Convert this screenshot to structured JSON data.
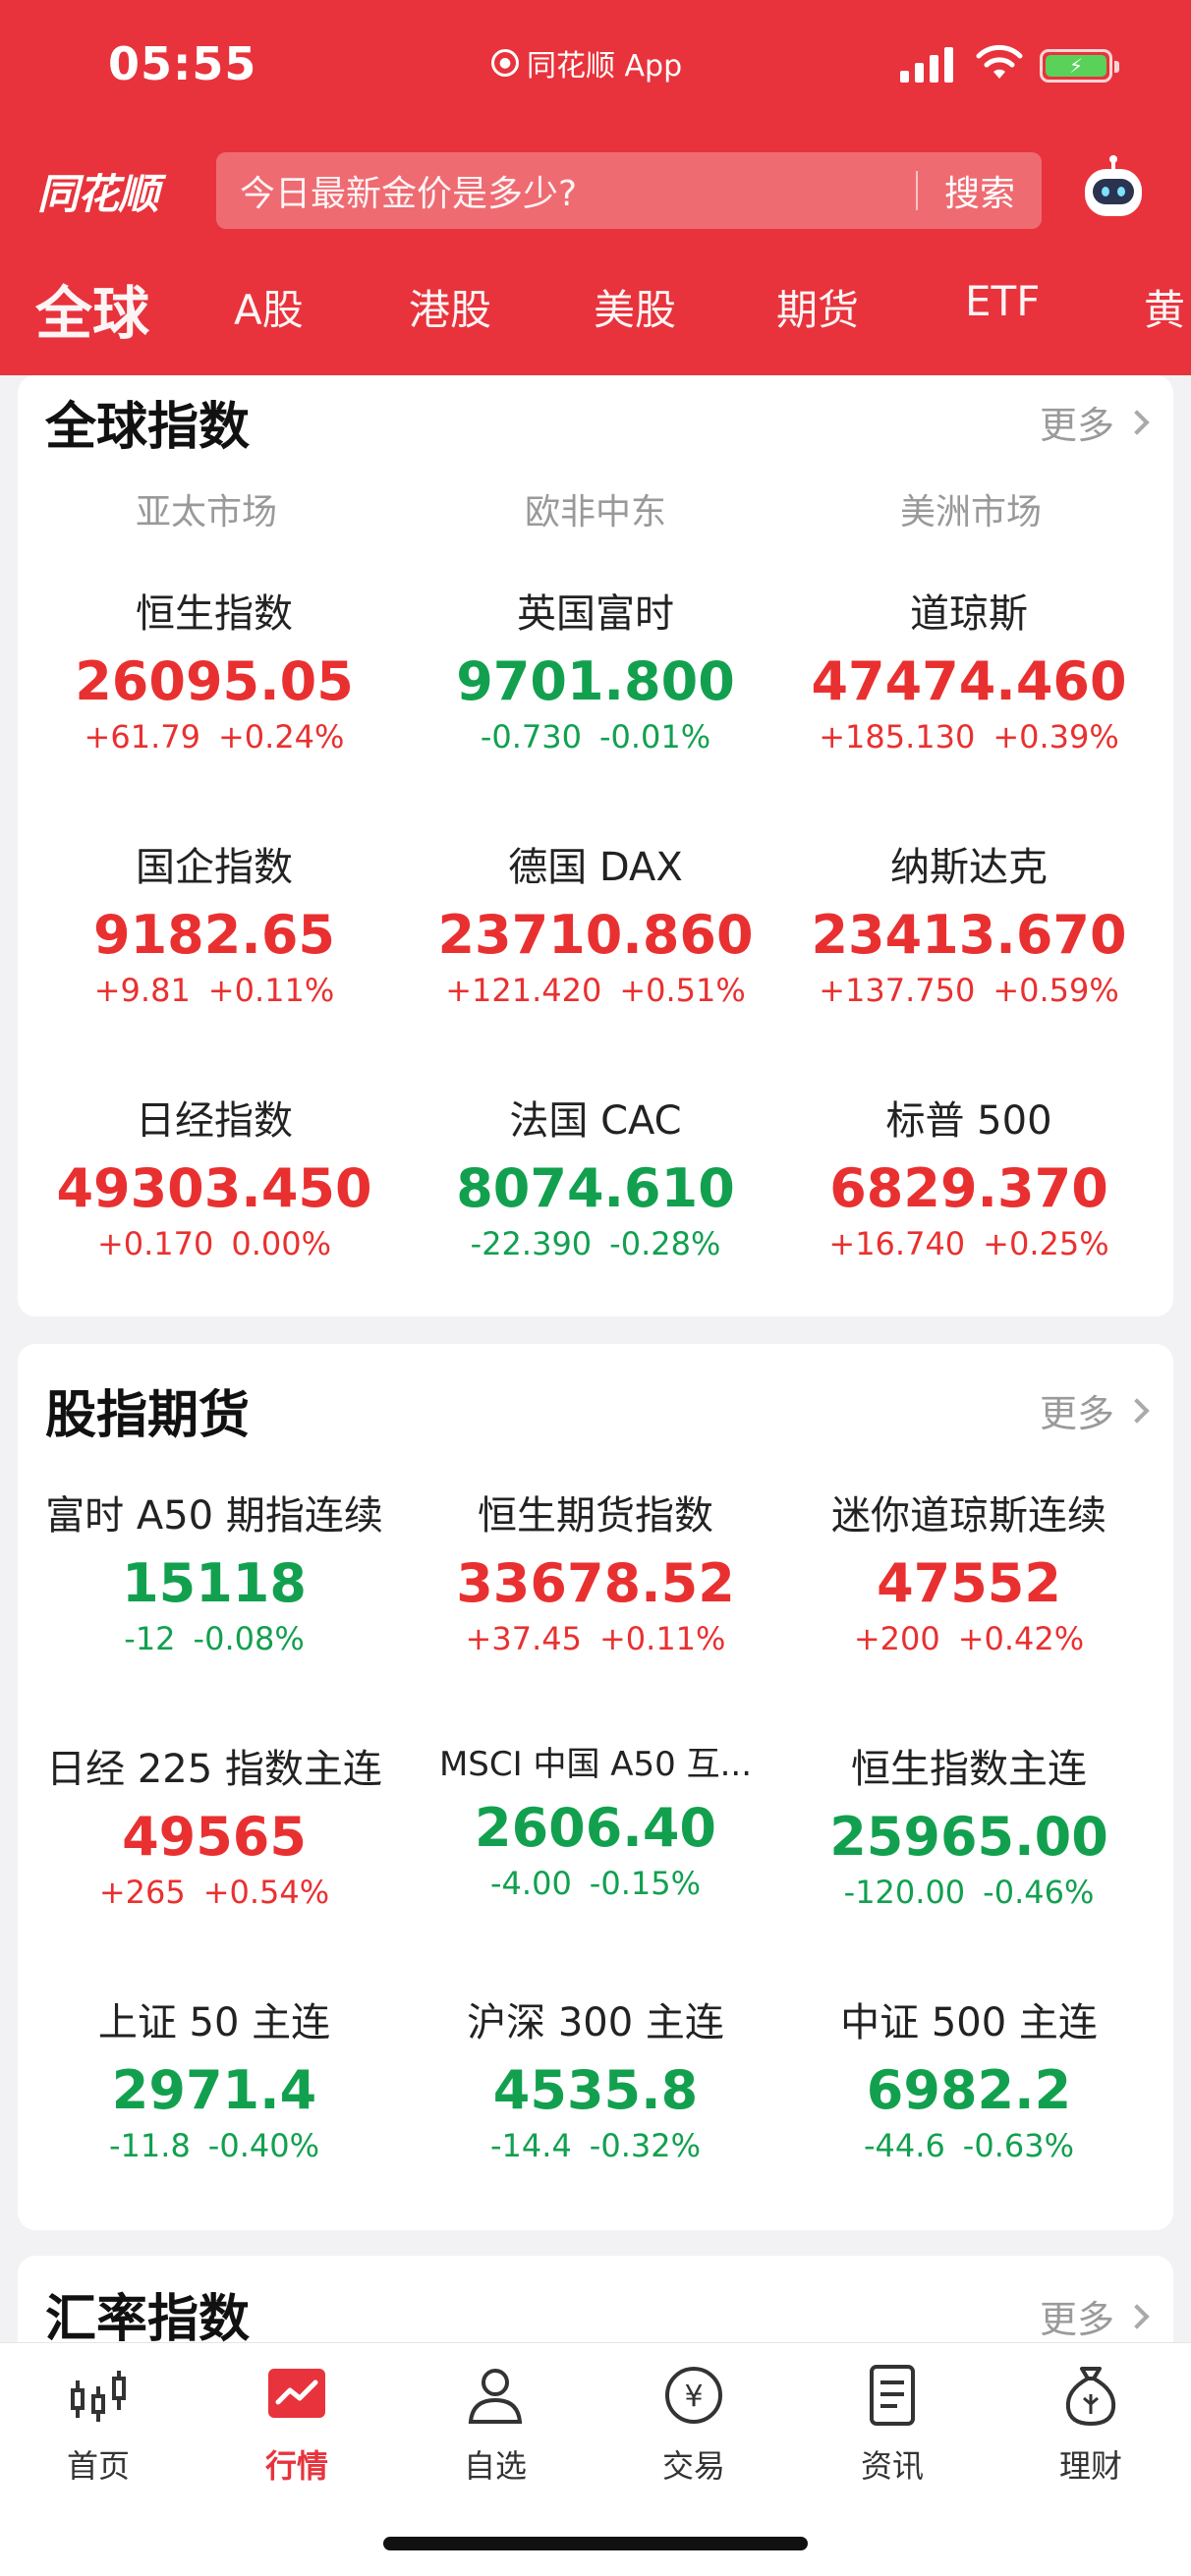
{
  "status_bar": {
    "time": "05:55",
    "app_label": "同花顺 App"
  },
  "header": {
    "logo": "同花顺",
    "search_placeholder": "今日最新金价是多少?",
    "search_button": "搜索"
  },
  "tabs": [
    "全球",
    "A股",
    "港股",
    "美股",
    "期货",
    "ETF",
    "黄"
  ],
  "global_indices": {
    "title": "全球指数",
    "more": "更多",
    "regions": [
      "亚太市场",
      "欧非中东",
      "美洲市场"
    ],
    "items": [
      {
        "name": "恒生指数",
        "price": "26095.05",
        "change": "+61.79",
        "pct": "+0.24%",
        "dir": "up"
      },
      {
        "name": "英国富时",
        "price": "9701.800",
        "change": "-0.730",
        "pct": "-0.01%",
        "dir": "down"
      },
      {
        "name": "道琼斯",
        "price": "47474.460",
        "change": "+185.130",
        "pct": "+0.39%",
        "dir": "up"
      },
      {
        "name": "国企指数",
        "price": "9182.65",
        "change": "+9.81",
        "pct": "+0.11%",
        "dir": "up"
      },
      {
        "name": "德国 DAX",
        "price": "23710.860",
        "change": "+121.420",
        "pct": "+0.51%",
        "dir": "up"
      },
      {
        "name": "纳斯达克",
        "price": "23413.670",
        "change": "+137.750",
        "pct": "+0.59%",
        "dir": "up"
      },
      {
        "name": "日经指数",
        "price": "49303.450",
        "change": "+0.170",
        "pct": "0.00%",
        "dir": "up"
      },
      {
        "name": "法国 CAC",
        "price": "8074.610",
        "change": "-22.390",
        "pct": "-0.28%",
        "dir": "down"
      },
      {
        "name": "标普 500",
        "price": "6829.370",
        "change": "+16.740",
        "pct": "+0.25%",
        "dir": "up"
      }
    ]
  },
  "index_futures": {
    "title": "股指期货",
    "more": "更多",
    "items": [
      {
        "name": "富时 A50 期指连续",
        "price": "15118",
        "change": "-12",
        "pct": "-0.08%",
        "dir": "down"
      },
      {
        "name": "恒生期货指数",
        "price": "33678.52",
        "change": "+37.45",
        "pct": "+0.11%",
        "dir": "up"
      },
      {
        "name": "迷你道琼斯连续",
        "price": "47552",
        "change": "+200",
        "pct": "+0.42%",
        "dir": "up"
      },
      {
        "name": "日经 225 指数主连",
        "price": "49565",
        "change": "+265",
        "pct": "+0.54%",
        "dir": "up"
      },
      {
        "name": "MSCI 中国 A50 互...",
        "price": "2606.40",
        "change": "-4.00",
        "pct": "-0.15%",
        "dir": "down"
      },
      {
        "name": "恒生指数主连",
        "price": "25965.00",
        "change": "-120.00",
        "pct": "-0.46%",
        "dir": "down"
      },
      {
        "name": "上证 50 主连",
        "price": "2971.4",
        "change": "-11.8",
        "pct": "-0.40%",
        "dir": "down"
      },
      {
        "name": "沪深 300 主连",
        "price": "4535.8",
        "change": "-14.4",
        "pct": "-0.32%",
        "dir": "down"
      },
      {
        "name": "中证 500 主连",
        "price": "6982.2",
        "change": "-44.6",
        "pct": "-0.63%",
        "dir": "down"
      }
    ]
  },
  "fx_index": {
    "title": "汇率指数",
    "more": "更多"
  },
  "bottom_nav": [
    "首页",
    "行情",
    "自选",
    "交易",
    "资讯",
    "理财"
  ],
  "colors": {
    "brand_red": "#e8333c",
    "up": "#e93030",
    "down": "#12a04f"
  }
}
